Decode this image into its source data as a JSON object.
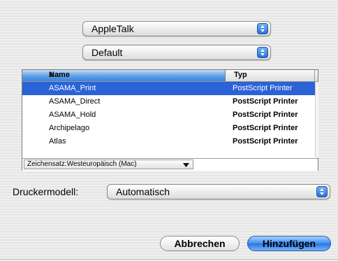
{
  "connection_popup": {
    "value": "AppleTalk"
  },
  "zone_popup": {
    "value": "Default"
  },
  "printer_list": {
    "columns": [
      "Name",
      "Typ"
    ],
    "sort_indicator": "▲",
    "rows": [
      {
        "name": "ASAMA_Print",
        "type": "PostScript Printer",
        "selected": true
      },
      {
        "name": "ASAMA_Direct",
        "type": "PostScript Printer",
        "selected": false
      },
      {
        "name": "ASAMA_Hold",
        "type": "PostScript Printer",
        "selected": false
      },
      {
        "name": "Archipelago",
        "type": "PostScript Printer",
        "selected": false
      },
      {
        "name": "Atlas",
        "type": "PostScript Printer",
        "selected": false
      }
    ],
    "encoding": "Zeichensatz:Westeuropäisch (Mac)"
  },
  "printer_model": {
    "label": "Druckermodell:",
    "value": "Automatisch"
  },
  "buttons": {
    "cancel": "Abbrechen",
    "add": "Hinzufügen"
  },
  "colors": {
    "accent": "#2b62d6",
    "default_button": "#3c8cf0",
    "header_selected": "#5e9ee8"
  },
  "icons": {
    "popup_arrows": "up-down-chevron-icon",
    "sort": "sort-ascending-icon",
    "encoding_arrow": "triangle-down-icon"
  }
}
